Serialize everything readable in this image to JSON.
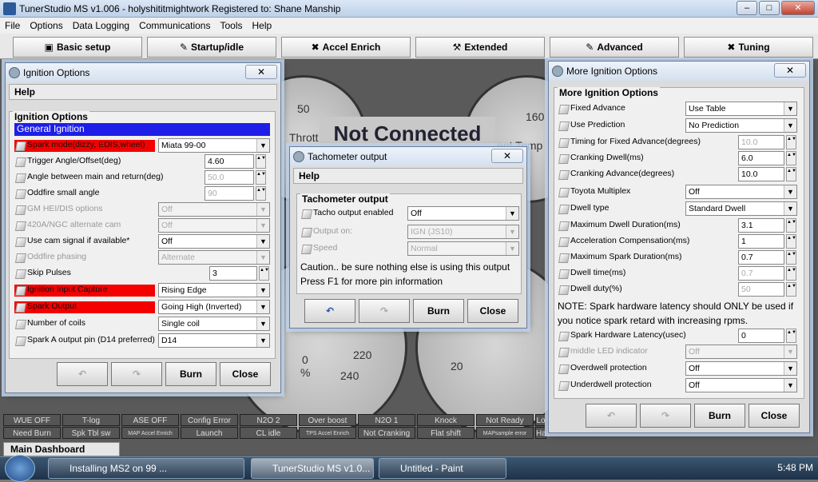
{
  "app": {
    "title": "TunerStudio MS v1.006 - holyshititmightwork Registered to: Shane Manship"
  },
  "menu": [
    "File",
    "Options",
    "Data Logging",
    "Communications",
    "Tools",
    "Help"
  ],
  "toolbar": [
    "Basic setup",
    "Startup/idle",
    "Accel Enrich",
    "Extended",
    "Advanced",
    "Tuning"
  ],
  "dashboard": {
    "not_connected": "Not Connected",
    "throttle": "Thrott",
    "vent_temp": "ent Temp",
    "ticks": [
      "50",
      "160",
      "%",
      "0",
      "220",
      "240",
      "20"
    ],
    "main_tab": "Main Dashboard"
  },
  "indicators": [
    [
      "WUE OFF",
      "T-log",
      "ASE OFF",
      "Config Error",
      "N2O 2",
      "Over boost",
      "N2O 1",
      "Knock",
      "Not Ready",
      "Lo"
    ],
    [
      "Need Burn",
      "Spk Tbl sw",
      "MAP Accel Enrich",
      "Launch",
      "CL idle",
      "TPS Accel Enrich",
      "Not Cranking",
      "Flat shift",
      "MAPsample error",
      "Ha"
    ]
  ],
  "ign": {
    "title": "Ignition Options",
    "help": "Help",
    "group": "Ignition Options",
    "section": "General Ignition",
    "rows": [
      {
        "label": "Spark mode(dizzy, EDIS,wheel)",
        "value": "Miata 99-00"
      },
      {
        "label": "Trigger Angle/Offset(deg)",
        "value": "4.60"
      },
      {
        "label": "Angle between main and return(deg)",
        "value": "50.0"
      },
      {
        "label": "Oddfire small angle",
        "value": "90"
      },
      {
        "label": "GM HEI/DIS options",
        "value": "Off"
      },
      {
        "label": "420A/NGC alternate cam",
        "value": "Off"
      },
      {
        "label": "Use cam signal if available*",
        "value": "Off"
      },
      {
        "label": "Oddfire phasing",
        "value": "Alternate"
      },
      {
        "label": "Skip Pulses",
        "value": "3"
      },
      {
        "label": "Ignition Input Capture",
        "value": "Rising Edge"
      },
      {
        "label": "Spark Output",
        "value": "Going High (Inverted)"
      },
      {
        "label": "Number of coils",
        "value": "Single coil"
      },
      {
        "label": "Spark A output pin (D14 preferred)",
        "value": "D14"
      }
    ],
    "burn": "Burn",
    "close": "Close"
  },
  "tach": {
    "title": "Tachometer output",
    "help": "Help",
    "group": "Tachometer output",
    "rows": [
      {
        "label": "Tacho output enabled",
        "value": "Off"
      },
      {
        "label": "Output on:",
        "value": "IGN (JS10)"
      },
      {
        "label": "Speed",
        "value": "Normal"
      }
    ],
    "note1": "Caution.. be sure nothing else is using this output",
    "note2": "Press F1 for more pin information",
    "burn": "Burn",
    "close": "Close"
  },
  "more": {
    "title": "More Ignition Options",
    "group": "More Ignition Options",
    "rows": [
      {
        "label": "Fixed Advance",
        "value": "Use Table"
      },
      {
        "label": "Use Prediction",
        "value": "No Prediction"
      },
      {
        "label": "Timing for Fixed Advance(degrees)",
        "value": "10.0"
      },
      {
        "label": "Cranking Dwell(ms)",
        "value": "6.0"
      },
      {
        "label": "Cranking Advance(degrees)",
        "value": "10.0"
      },
      {
        "label": "Toyota Multiplex",
        "value": "Off"
      },
      {
        "label": "Dwell type",
        "value": "Standard Dwell"
      },
      {
        "label": "Maximum Dwell Duration(ms)",
        "value": "3.1"
      },
      {
        "label": "Acceleration Compensation(ms)",
        "value": "1"
      },
      {
        "label": "Maximum Spark Duration(ms)",
        "value": "0.7"
      },
      {
        "label": "Dwell time(ms)",
        "value": "0.7"
      },
      {
        "label": "Dwell duty(%)",
        "value": "50"
      },
      {
        "label": "Spark Hardware Latency(usec)",
        "value": "0"
      },
      {
        "label": "middle LED indicator",
        "value": "Off"
      },
      {
        "label": "Overdwell protection",
        "value": "Off"
      },
      {
        "label": "Underdwell protection",
        "value": "Off"
      }
    ],
    "note1": "NOTE: Spark hardware latency should ONLY be used if",
    "note2": "you notice spark retard with increasing rpms.",
    "burn": "Burn",
    "close": "Close"
  },
  "taskbar": {
    "items": [
      "Installing MS2 on 99 ...",
      "TunerStudio MS v1.0...",
      "Untitled - Paint"
    ],
    "clock": "5:48 PM"
  }
}
